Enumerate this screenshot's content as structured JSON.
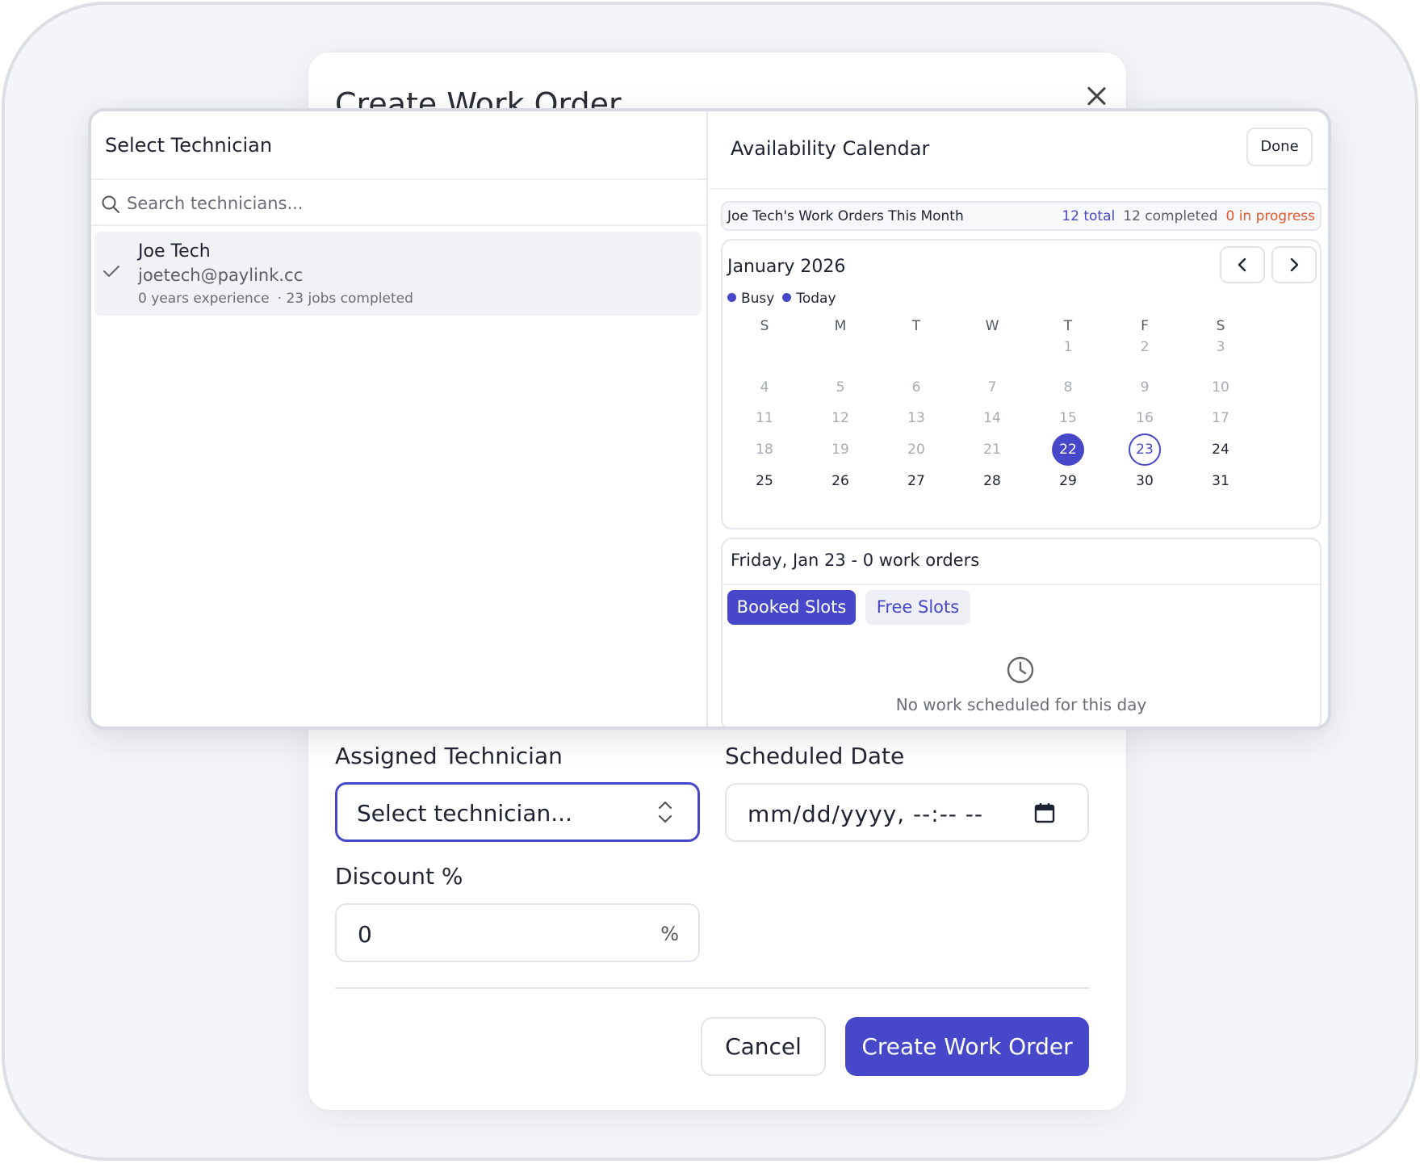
{
  "dialog": {
    "title": "Create Work Order",
    "close_icon": "close-icon",
    "assigned_label": "Assigned Technician",
    "assigned_placeholder": "Select technician...",
    "scheduled_label": "Scheduled Date",
    "scheduled_placeholder": "mm/dd/yyyy, --:-- --",
    "discount_label": "Discount %",
    "discount_value": "0",
    "discount_suffix": "%",
    "cancel_label": "Cancel",
    "create_label": "Create Work Order"
  },
  "technician_picker": {
    "title": "Select Technician",
    "search_placeholder": "Search technicians...",
    "technicians": [
      {
        "name": "Joe Tech",
        "email": "joetech@paylink.cc",
        "experience": "0 years experience",
        "jobs": "· 23 jobs completed",
        "selected": true
      }
    ]
  },
  "calendar": {
    "title": "Availability Calendar",
    "done_label": "Done",
    "stats": {
      "title": "Joe Tech's Work Orders This Month",
      "total": "12 total",
      "completed": "12 completed",
      "in_progress": "0 in progress"
    },
    "month_label": "January 2026",
    "legend": {
      "busy": "Busy",
      "today": "Today"
    },
    "weekdays": [
      "S",
      "M",
      "T",
      "W",
      "T",
      "F",
      "S"
    ],
    "busy_day": 22,
    "today_day": 23,
    "colors": {
      "accent": "#4748c9",
      "in_progress": "#e0592a"
    },
    "selected_day_heading": "Friday, Jan 23 - 0 work orders",
    "tabs": {
      "booked": "Booked Slots",
      "free": "Free Slots"
    },
    "empty_message": "No work scheduled for this day"
  }
}
